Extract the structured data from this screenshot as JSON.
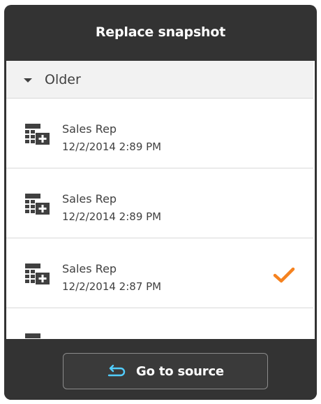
{
  "dialog": {
    "title": "Replace snapshot"
  },
  "group": {
    "label": "Older",
    "expanded": true
  },
  "snapshots": [
    {
      "name": "Sales Rep",
      "date": "12/2/2014 2:89 PM",
      "selected": false,
      "icon": "table-plus-icon"
    },
    {
      "name": "Sales Rep",
      "date": "12/2/2014 2:89 PM",
      "selected": false,
      "icon": "table-plus-icon"
    },
    {
      "name": "Sales Rep",
      "date": "12/2/2014 2:87 PM",
      "selected": true,
      "icon": "table-plus-icon"
    }
  ],
  "footer": {
    "go_to_source_label": "Go to source",
    "icon": "return-arrow-icon"
  },
  "colors": {
    "panel_bg": "#333333",
    "accent_blue": "#52cdff",
    "check_orange": "#f5821f"
  }
}
